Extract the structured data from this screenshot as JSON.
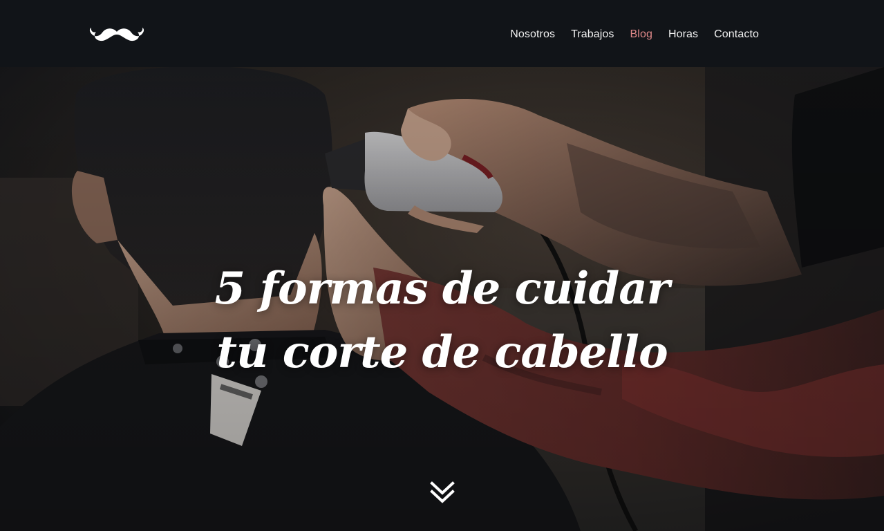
{
  "header": {
    "logo": {
      "icon": "mustache-icon",
      "color": "#ffffff"
    },
    "nav": [
      {
        "label": "Nosotros",
        "active": false
      },
      {
        "label": "Trabajos",
        "active": false
      },
      {
        "label": "Blog",
        "active": true
      },
      {
        "label": "Horas",
        "active": false
      },
      {
        "label": "Contacto",
        "active": false
      }
    ],
    "active_color": "#e0898a"
  },
  "hero": {
    "title_line_1": "5 formas de cuidar",
    "title_line_2": "tu corte de cabello",
    "scroll_icon": "double-chevron-down-icon"
  }
}
